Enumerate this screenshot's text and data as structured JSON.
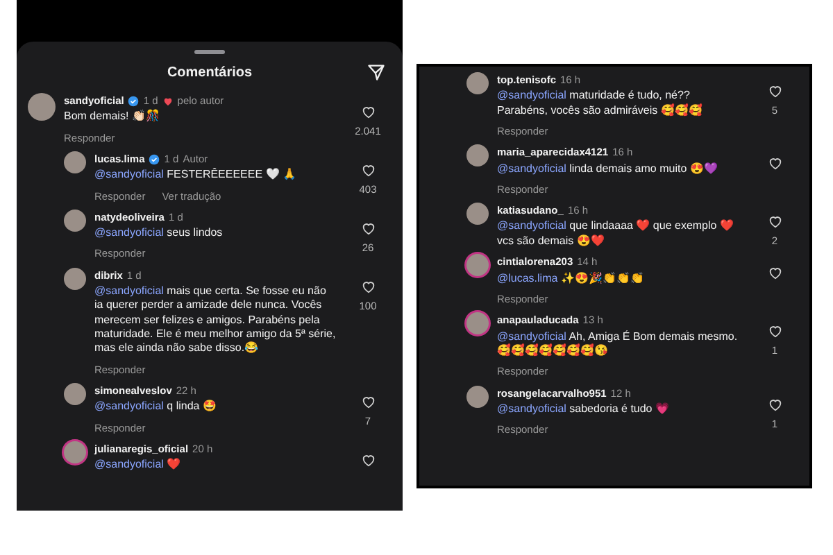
{
  "left_panel": {
    "title": "Comentários",
    "comments": [
      {
        "username": "sandyoficial",
        "verified": true,
        "time": "1 d",
        "badge": "pelo autor",
        "liked_by_author": true,
        "text": "Bom demais! 👏🏻🎊",
        "actions": [
          "Responder"
        ],
        "likes": "2.041",
        "story_ring": false,
        "children": [
          {
            "username": "lucas.lima",
            "verified": true,
            "time": "1 d",
            "badge": "Autor",
            "mention": "@sandyoficial",
            "text": "FESTERÊEEEEEE 🤍 🙏",
            "actions": [
              "Responder",
              "Ver tradução"
            ],
            "likes": "403",
            "story_ring": false
          },
          {
            "username": "natydeoliveira",
            "time": "1 d",
            "mention": "@sandyoficial",
            "text": "seus lindos",
            "actions": [
              "Responder"
            ],
            "likes": "26",
            "story_ring": false
          },
          {
            "username": "dibrix",
            "time": "1 d",
            "mention": "@sandyoficial",
            "text": "mais que certa. Se fosse eu não ia querer perder a amizade dele nunca. Vocês merecem ser felizes e amigos. Parabéns pela maturidade. Ele é meu melhor amigo da 5ª série, mas ele ainda não sabe disso.😂",
            "actions": [
              "Responder"
            ],
            "likes": "100",
            "story_ring": false
          },
          {
            "username": "simonealveslov",
            "time": "22 h",
            "mention": "@sandyoficial",
            "text": "q linda 🤩",
            "actions": [
              "Responder"
            ],
            "likes": "7",
            "story_ring": false
          },
          {
            "username": "julianaregis_oficial",
            "time": "20 h",
            "mention": "@sandyoficial",
            "text": "❤️",
            "story_ring": true
          }
        ]
      }
    ]
  },
  "right_panel": {
    "comments": [
      {
        "username": "top.tenisofc",
        "time": "16 h",
        "mention": "@sandyoficial",
        "text": "maturidade é tudo, né?? Parabéns, vocês são admiráveis 🥰🥰🥰",
        "actions": [
          "Responder"
        ],
        "likes": "5",
        "story_ring": false
      },
      {
        "username": "maria_aparecidax4121",
        "time": "16 h",
        "mention": "@sandyoficial",
        "text": "linda demais amo muito 😍💜",
        "actions": [
          "Responder"
        ],
        "story_ring": false
      },
      {
        "username": "katiasudano_",
        "time": "16 h",
        "mention": "@sandyoficial",
        "text": "que lindaaaa ❤️ que exemplo ❤️ vcs são demais 😍❤️",
        "likes": "2",
        "story_ring": false
      },
      {
        "username": "cintialorena203",
        "time": "14 h",
        "mention": "@lucas.lima",
        "text": "✨😍🎉👏👏👏",
        "actions": [
          "Responder"
        ],
        "story_ring": true
      },
      {
        "username": "anapauladucada",
        "time": "13 h",
        "mention": "@sandyoficial",
        "text": "Ah, Amiga É Bom demais mesmo. 🥰🥰🥰🥰🥰🥰🥰😘",
        "actions": [
          "Responder"
        ],
        "likes": "1",
        "story_ring": true
      },
      {
        "username": "rosangelacarvalho951",
        "time": "12 h",
        "mention": "@sandyoficial",
        "text": "sabedoria é tudo 💗",
        "actions": [
          "Responder"
        ],
        "likes": "1",
        "story_ring": false
      }
    ]
  }
}
